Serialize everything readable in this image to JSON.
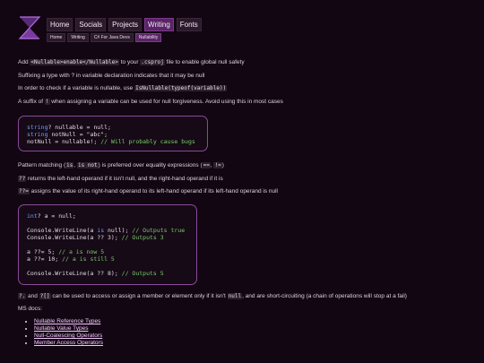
{
  "nav": {
    "items": [
      {
        "label": "Home",
        "active": false
      },
      {
        "label": "Socials",
        "active": false
      },
      {
        "label": "Projects",
        "active": false
      },
      {
        "label": "Writing",
        "active": true
      },
      {
        "label": "Fonts",
        "active": false
      }
    ]
  },
  "breadcrumb": [
    "Home",
    "Writing",
    "C# For Java Devs",
    "Nullability"
  ],
  "paragraphs": {
    "p1_a": "Add ",
    "p1_code1": "<Nullable>enable</Nullable>",
    "p1_b": " to your ",
    "p1_code2": ".csproj",
    "p1_c": " file to enable global null safety",
    "p2": "Suffixing a type with ? in variable declaration indicates that it may be null",
    "p3_a": "In order to check if a variable is nullable, use ",
    "p3_code": "IsNullable(typeof(variable))",
    "p4_a": "A suffix of ",
    "p4_code": "!",
    "p4_b": " when assigning a variable can be used for null forgiveness. Avoid using this in most cases",
    "p5_a": "Pattern matching (",
    "p5_code1": "is",
    "p5_b": ", ",
    "p5_code2": "is not",
    "p5_c": ") is preferred over equality expressions (",
    "p5_code3": "==",
    "p5_d": ", ",
    "p5_code4": "!=",
    "p5_e": ")",
    "p6_code": "??",
    "p6_b": " returns the left-hand operand if it isn't null, and the right-hand operand if it is",
    "p7_code": "??=",
    "p7_b": " assigns the value of its right-hand operand to its left-hand operand if its left-hand operand is null",
    "p8_code1": "?.",
    "p8_a": " and ",
    "p8_code2": "?[]",
    "p8_b": " can be used to access or assign a member or element only if it isn't ",
    "p8_code3": "null",
    "p8_c": ", and are short-circuiting (a chain of operations will stop at a fail)",
    "p9": "MS docs:"
  },
  "code1": {
    "l1_kw": "string",
    "l1": "? nullable = null;",
    "l2_kw": "string",
    "l2": " notNull = \"abc\";",
    "l3": "notNull = nullable!; ",
    "l3_cm": "// Will probably cause bugs"
  },
  "code2": {
    "l1_kw": "int",
    "l1": "? a = null;",
    "l2_a": "Console.WriteLine(a ",
    "l2_kw": "is",
    "l2_b": " null); ",
    "l2_cm": "// Outputs true",
    "l3_a": "Console.WriteLine(a ?? 3); ",
    "l3_cm": "// Outputs 3",
    "l4_a": "a ??= 5; ",
    "l4_cm": "// a is now 5",
    "l5_a": "a ??= 10; ",
    "l5_cm": "// a is still 5",
    "l6_a": "Console.WriteLine(a ?? 8); ",
    "l6_cm": "// Outputs 5"
  },
  "docs_links": [
    "Nullable Reference Types",
    "Nullable Value Types",
    "Null-Coalescing Operators",
    "Member Access Operators"
  ]
}
